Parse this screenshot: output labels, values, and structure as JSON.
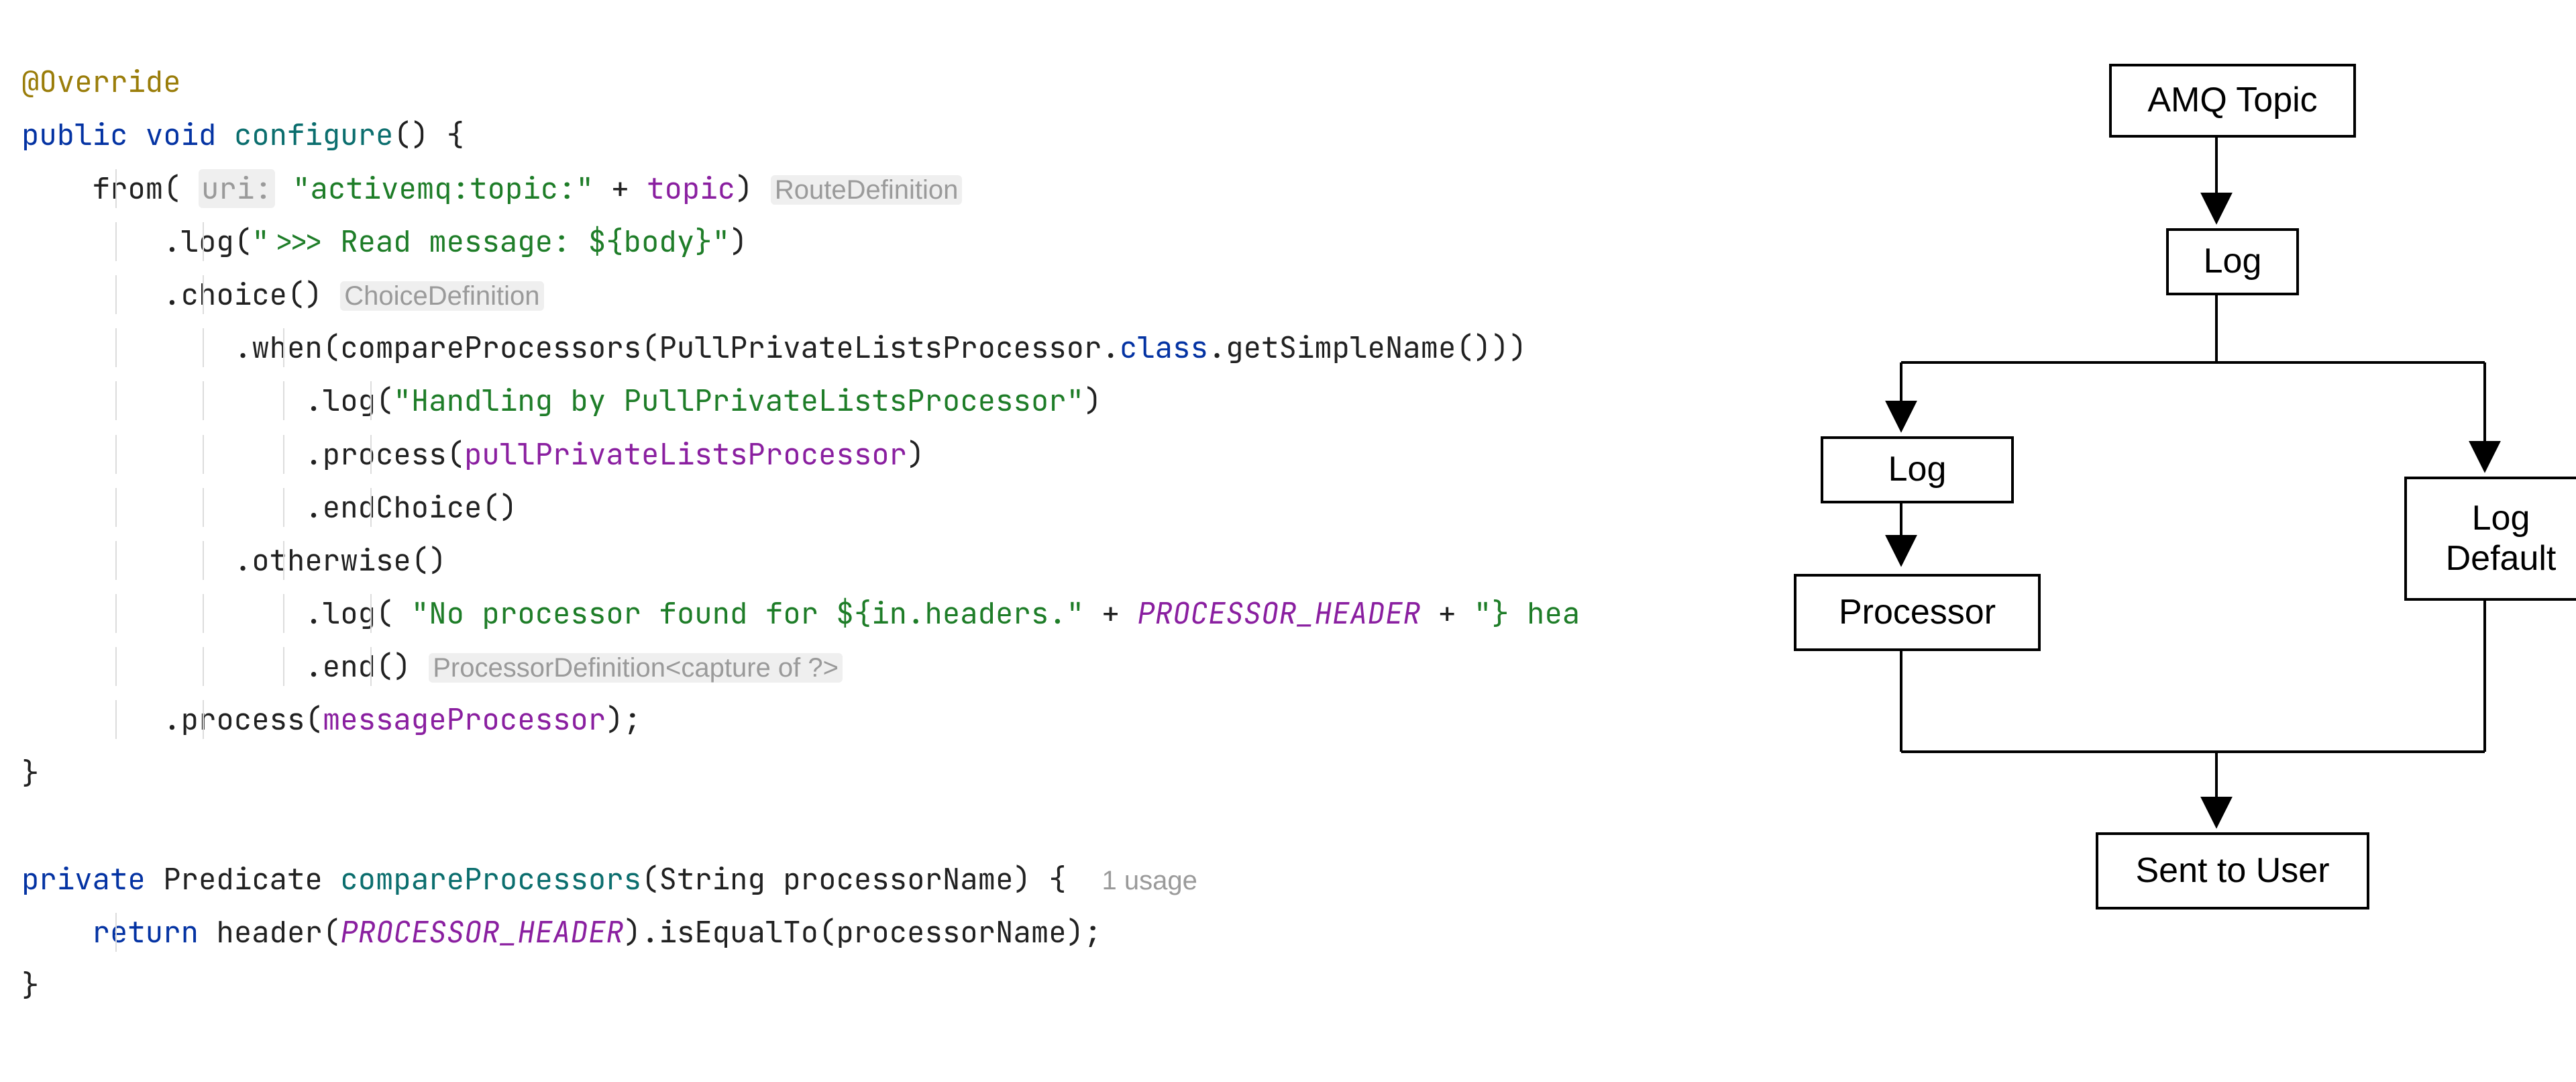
{
  "code": {
    "annotation": "@Override",
    "mod_public": "public",
    "mod_void": "void",
    "mod_private": "private",
    "kw_return": "return",
    "kw_class": "class",
    "m_configure": "configure",
    "m_compareProcessors": "compareProcessors",
    "type_Predicate": "Predicate",
    "type_String": "String",
    "param_processorName": "processorName",
    "call_from": "from",
    "hint_uri": "uri:",
    "str_activemq": "\"activemq:topic:\"",
    "field_topic": "topic",
    "hint_routeDef": "RouteDefinition",
    "call_log": ".log",
    "str_readmsg": "\">>> Read message: ${body}\"",
    "call_choice": ".choice()",
    "hint_choiceDef": "ChoiceDefinition",
    "call_when": ".when",
    "call_compareProcessors": "compareProcessors",
    "type_PullProc": "PullPrivateListsProcessor",
    "call_getSimpleName": ".getSimpleName()",
    "str_handling": "\"Handling by PullPrivateListsProcessor\"",
    "call_process": ".process",
    "field_pullProc": "pullPrivateListsProcessor",
    "call_endChoice": ".endChoice()",
    "call_otherwise": ".otherwise()",
    "str_noproc1": "\"No processor found for ${in.headers.\"",
    "const_header": "PROCESSOR_HEADER",
    "str_noproc2": "\"} hea",
    "call_end": ".end()",
    "hint_procDef": "ProcessorDefinition<capture of ?>",
    "field_msgProc": "messageProcessor",
    "call_header": "header",
    "call_isEqualTo": ".isEqualTo",
    "usage_1": "1 usage"
  },
  "diagram": {
    "n_amq": "AMQ Topic",
    "n_log": "Log",
    "n_log2": "Log",
    "n_logdef_l1": "Log",
    "n_logdef_l2": "Default",
    "n_proc": "Processor",
    "n_sent": "Sent to User"
  }
}
